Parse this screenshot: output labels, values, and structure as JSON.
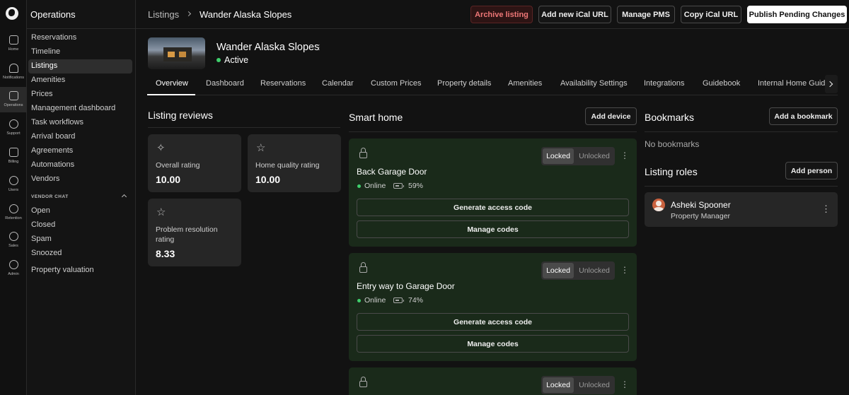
{
  "rail": [
    {
      "label": "Home",
      "icon": "home-icon"
    },
    {
      "label": "Notifications",
      "icon": "bell-icon"
    },
    {
      "label": "Operations",
      "icon": "box-icon"
    },
    {
      "label": "Support",
      "icon": "lifebuoy-icon"
    },
    {
      "label": "Billing",
      "icon": "receipt-icon"
    },
    {
      "label": "Users",
      "icon": "users-icon"
    },
    {
      "label": "Retention",
      "icon": "refresh-dollar-icon"
    },
    {
      "label": "Sales",
      "icon": "dollar-icon"
    },
    {
      "label": "Admin",
      "icon": "shield-icon"
    }
  ],
  "sidebar": {
    "title": "Operations",
    "items": [
      "Reservations",
      "Timeline",
      "Listings",
      "Amenities",
      "Prices",
      "Management dashboard",
      "Task workflows",
      "Arrival board",
      "Agreements",
      "Automations",
      "Vendors"
    ],
    "vendor_chat_heading": "VENDOR CHAT",
    "vendor_chat_items": [
      "Open",
      "Closed",
      "Spam",
      "Snoozed"
    ],
    "footer_item": "Property valuation"
  },
  "topbar": {
    "breadcrumb_root": "Listings",
    "breadcrumb_current": "Wander Alaska Slopes",
    "archive": "Archive listing",
    "add_ical": "Add new iCal URL",
    "manage_pms": "Manage PMS",
    "copy_ical": "Copy iCal URL",
    "publish": "Publish Pending Changes"
  },
  "listing": {
    "name": "Wander Alaska Slopes",
    "status": "Active"
  },
  "tabs": [
    "Overview",
    "Dashboard",
    "Reservations",
    "Calendar",
    "Custom Prices",
    "Property details",
    "Amenities",
    "Availability Settings",
    "Integrations",
    "Guidebook",
    "Internal Home Guide"
  ],
  "reviews": {
    "title": "Listing reviews",
    "cards": [
      {
        "label": "Overall rating",
        "value": "10.00"
      },
      {
        "label": "Home quality rating",
        "value": "10.00"
      },
      {
        "label": "Problem resolution rating",
        "value": "8.33"
      }
    ]
  },
  "smart_home": {
    "title": "Smart home",
    "add_device": "Add device",
    "locked_label": "Locked",
    "unlocked_label": "Unlocked",
    "generate_label": "Generate access code",
    "manage_label": "Manage codes",
    "devices": [
      {
        "name": "Back Garage Door",
        "status": "Online",
        "battery": "59%"
      },
      {
        "name": "Entry way to Garage Door",
        "status": "Online",
        "battery": "74%"
      },
      {
        "name": "",
        "status": "",
        "battery": ""
      }
    ]
  },
  "bookmarks": {
    "title": "Bookmarks",
    "add": "Add a bookmark",
    "empty": "No bookmarks"
  },
  "roles": {
    "title": "Listing roles",
    "add": "Add person",
    "people": [
      {
        "name": "Asheki Spooner",
        "role": "Property Manager"
      }
    ]
  }
}
